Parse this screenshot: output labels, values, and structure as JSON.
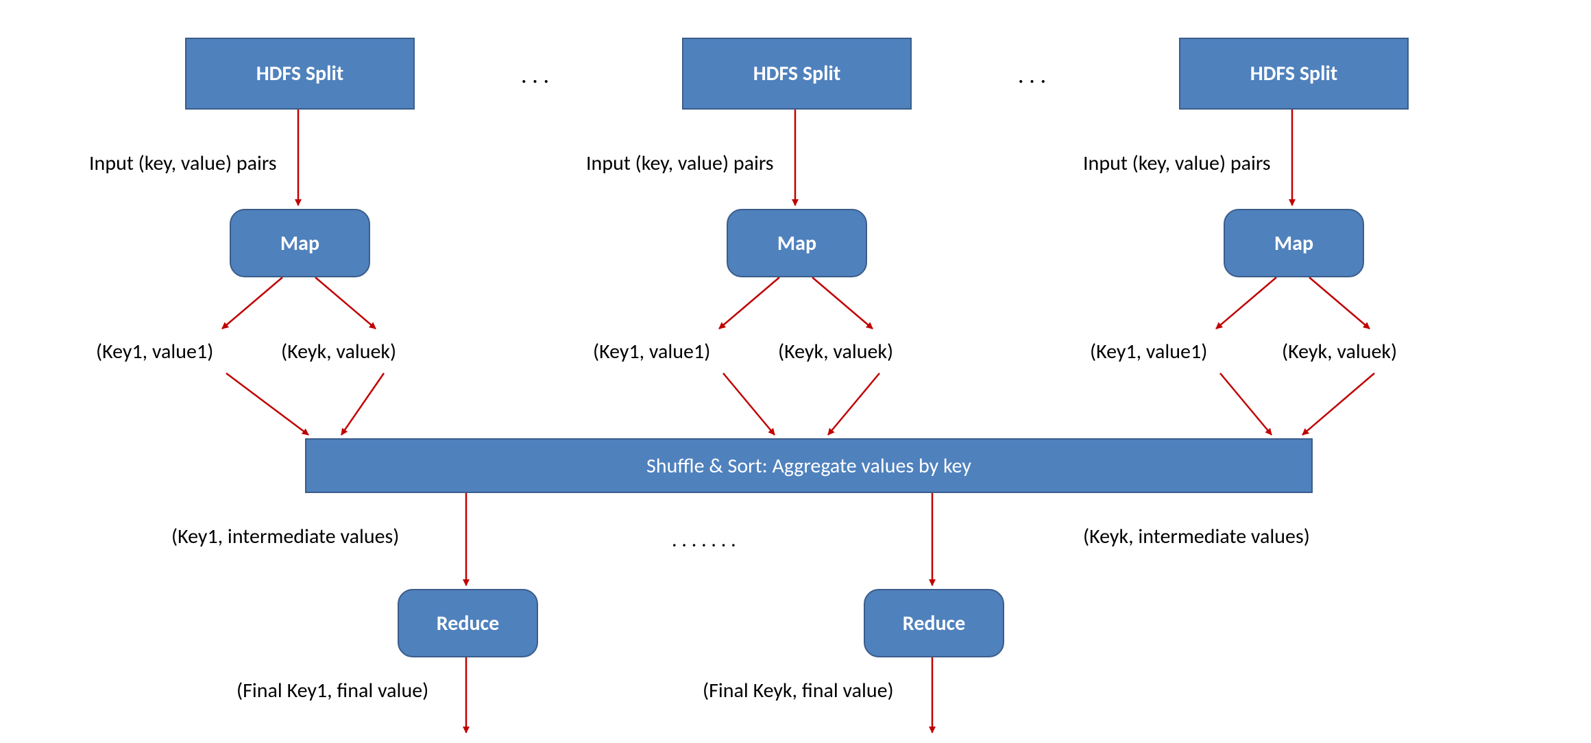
{
  "colors": {
    "box_fill": "#4f81bd",
    "box_border": "#3b5d8a",
    "arrow": "#c00000"
  },
  "hdfs": {
    "a": "HDFS Split",
    "b": "HDFS Split",
    "c": "HDFS Split"
  },
  "ellipsis_top": {
    "a": ". . .",
    "b": ". . ."
  },
  "input_label": {
    "a": "Input (key, value) pairs",
    "b": "Input (key, value) pairs",
    "c": "Input (key, value) pairs"
  },
  "map": {
    "a": "Map",
    "b": "Map",
    "c": "Map"
  },
  "kv": {
    "a1": "(Key1, value1)",
    "ak": "(Keyk, valuek)",
    "b1": "(Key1, value1)",
    "bk": "(Keyk, valuek)",
    "c1": "(Key1, value1)",
    "ck": "(Keyk, valuek)"
  },
  "shuffle": "Shuffle & Sort: Aggregate values by key",
  "inter": {
    "left": "(Key1, intermediate values)",
    "right": "(Keyk, intermediate values)"
  },
  "ellipsis_mid": ". . . . . . .",
  "reduce": {
    "left": "Reduce",
    "right": "Reduce"
  },
  "final": {
    "left": "(Final Key1, final value)",
    "right": "(Final Keyk, final value)"
  }
}
